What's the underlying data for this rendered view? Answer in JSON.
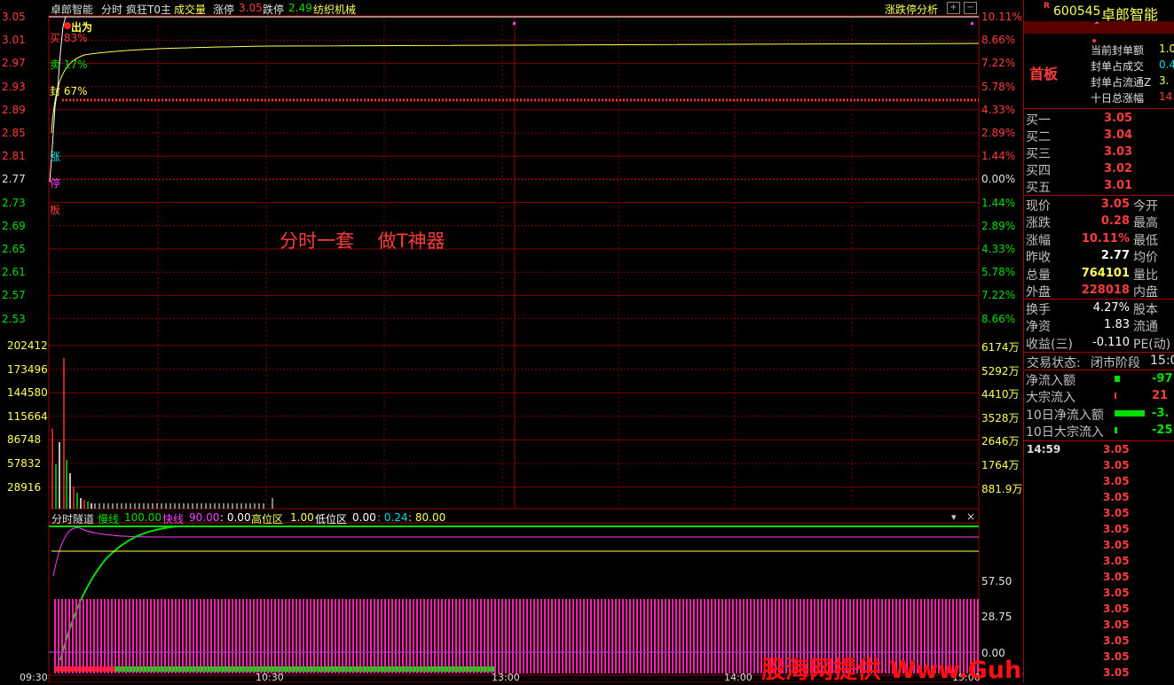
{
  "header": {
    "stock_name": "卓郎智能",
    "mode": "分时",
    "indicator": "疯狂T0主",
    "vol_label": "成交量",
    "limit_up_label": "涨停",
    "limit_up_value": "3.05",
    "limit_down_label": "跌停",
    "limit_down_value": "2.49",
    "sector": "纺织机械",
    "analysis_button": "涨跌停分析"
  },
  "price_axis": [
    "3.05",
    "3.01",
    "2.97",
    "2.93",
    "2.89",
    "2.85",
    "2.81",
    "2.77",
    "2.73",
    "2.69",
    "2.65",
    "2.61",
    "2.57",
    "2.53"
  ],
  "pct_axis": [
    "10.11%",
    "8.66%",
    "7.22%",
    "5.78%",
    "4.33%",
    "2.89%",
    "1.44%",
    "0.00%",
    "1.44%",
    "2.89%",
    "4.33%",
    "5.78%",
    "7.22%",
    "8.66%"
  ],
  "vol_axis_left": [
    "202412",
    "173496",
    "144580",
    "115664",
    "86748",
    "57832",
    "28916"
  ],
  "vol_axis_right": [
    "6174万",
    "5292万",
    "4410万",
    "3528万",
    "2646万",
    "1764万",
    "881.9万"
  ],
  "time_axis": [
    "09:30",
    "10:30",
    "13:00",
    "14:00",
    "15:00"
  ],
  "annotations": {
    "lu": "出为",
    "buy": "买 83%",
    "sell": "卖 17%",
    "seal": "封 67%",
    "zhang": "涨",
    "ting": "停",
    "ban": "板",
    "center_text": "分时一套    做T神器"
  },
  "sub_indicator": {
    "name": "分时隧道",
    "slow_label": "慢线",
    "slow_value": "100.00",
    "fast_label": "快线",
    "fast_value": "90.00",
    "v3": ": 0.00",
    "high_label": "高位区",
    "high_value": "1.00",
    "low_label": "低位区",
    "low_value": "0.00",
    "v6": ": 0.24",
    "v7": ": 80.00",
    "axis": [
      "57.50",
      "28.75",
      "0.00"
    ]
  },
  "watermark": "股海网提供 Www.Guhai.Com.CN",
  "right_panel": {
    "code": "600545",
    "name": "卓郎智能",
    "tag": "首板",
    "seal_items": [
      {
        "label": "当前封单额",
        "value": "1.0"
      },
      {
        "label": "封单占成交",
        "value": "0.4"
      },
      {
        "label": "封单占流通Z",
        "value": "3."
      },
      {
        "label": "十日总涨幅",
        "value": "14."
      }
    ],
    "bids": [
      {
        "label": "买一",
        "value": "3.05"
      },
      {
        "label": "买二",
        "value": "3.04"
      },
      {
        "label": "买三",
        "value": "3.03"
      },
      {
        "label": "买四",
        "value": "3.02"
      },
      {
        "label": "买五",
        "value": "3.01"
      }
    ],
    "quote": [
      {
        "label": "现价",
        "value": "3.05",
        "label2": "今开",
        "color": "#ff3c3c"
      },
      {
        "label": "涨跌",
        "value": "0.28",
        "label2": "最高",
        "color": "#ff3c3c"
      },
      {
        "label": "涨幅",
        "value": "10.11%",
        "label2": "最低",
        "color": "#ff3c3c"
      },
      {
        "label": "昨收",
        "value": "2.77",
        "label2": "均价",
        "color": "#ffffff"
      },
      {
        "label": "总量",
        "value": "764101",
        "label2": "量比",
        "color": "#ffff54"
      },
      {
        "label": "外盘",
        "value": "228018",
        "label2": "内盘",
        "color": "#ff3c3c"
      }
    ],
    "quote2": [
      {
        "label": "换手",
        "value": "4.27%",
        "label2": "股本",
        "color": "#ffffff"
      },
      {
        "label": "净资",
        "value": "1.83",
        "label2": "流通",
        "color": "#ffffff"
      },
      {
        "label": "收益(三)",
        "value": "-0.110",
        "label2": "PE(动)",
        "color": "#ffffff"
      }
    ],
    "status_label": "交易状态:",
    "status_value": "闭市阶段",
    "status_time": "15:0",
    "flows": [
      {
        "label": "净流入额",
        "value": "-97",
        "color": "#00e000"
      },
      {
        "label": "大宗流入",
        "value": "21",
        "color": "#ff3c3c"
      },
      {
        "label": "10日净流入额",
        "value": "-3.",
        "color": "#00e000"
      },
      {
        "label": "10日大宗流入",
        "value": "-25",
        "color": "#00e000"
      }
    ],
    "tick_time": "14:59",
    "ticks": [
      "3.05",
      "3.05",
      "3.05",
      "3.05",
      "3.05",
      "3.05",
      "3.05",
      "3.05",
      "3.05",
      "3.05",
      "3.05",
      "3.05",
      "3.05",
      "3.05",
      "3.05"
    ]
  }
}
